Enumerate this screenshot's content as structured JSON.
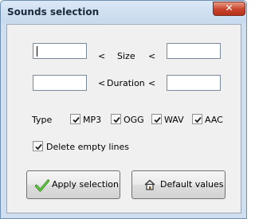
{
  "window": {
    "title": "Sounds selection",
    "close_glyph": "✕"
  },
  "size_row": {
    "min_value": "",
    "lt1": "<",
    "label": "Size",
    "lt2": "<",
    "max_value": ""
  },
  "duration_row": {
    "min_value": "",
    "lt1": "<",
    "label": "Duration",
    "lt2": "<",
    "max_value": ""
  },
  "type": {
    "label": "Type",
    "options": [
      {
        "label": "MP3",
        "checked": true
      },
      {
        "label": "OGG",
        "checked": true
      },
      {
        "label": "WAV",
        "checked": true
      },
      {
        "label": "AAC",
        "checked": true
      }
    ]
  },
  "delete_empty": {
    "label": "Delete empty lines",
    "checked": true
  },
  "buttons": {
    "apply": {
      "label": "Apply selection",
      "icon": "green-check-icon"
    },
    "defaults": {
      "label": "Default values",
      "icon": "house-icon"
    }
  }
}
